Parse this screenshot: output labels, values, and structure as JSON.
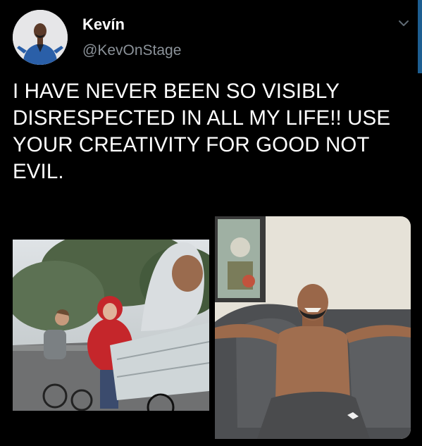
{
  "tweet": {
    "author": {
      "name": "Kevín",
      "handle": "@KevOnStage"
    },
    "text": "I HAVE NEVER BEEN SO VISIBLY\nDISRESPECTED IN ALL MY LIFE!! USE\nYOUR CREATIVITY FOR GOOD NOT\nEVIL.",
    "media": [
      {
        "kind": "photo"
      },
      {
        "kind": "photo"
      }
    ]
  },
  "icons": {
    "menu": "chevron-down-icon",
    "avatar": "avatar"
  },
  "colors": {
    "background": "#000000",
    "text": "#ffffff",
    "secondary_text": "#8b9299",
    "accent_edge": "#1d5e91"
  }
}
